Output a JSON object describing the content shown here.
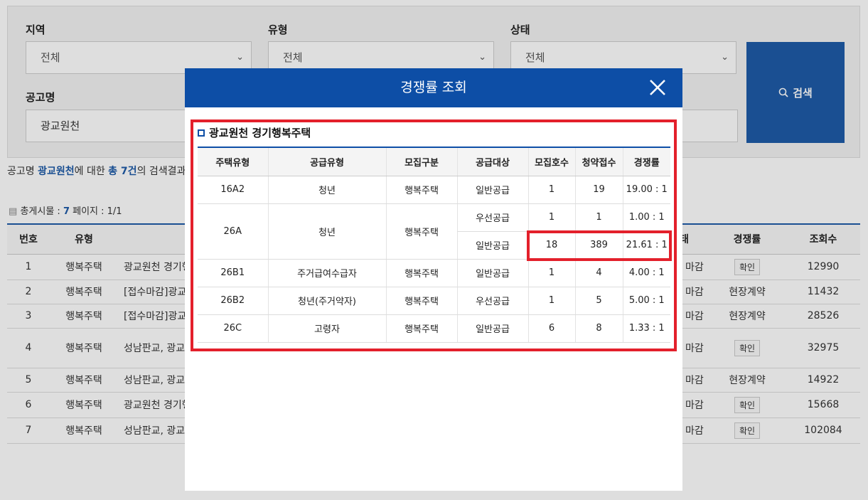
{
  "search": {
    "region_label": "지역",
    "region_value": "전체",
    "type_label": "유형",
    "type_value": "전체",
    "status_label": "상태",
    "status_value": "전체",
    "notice_label": "공고명",
    "notice_value": "광교원천",
    "search_button": "검색"
  },
  "summary": {
    "prefix": "공고명 ",
    "keyword": "광교원천",
    "middle": "에 대한 ",
    "count": "총 7건",
    "suffix": "의 검색결과"
  },
  "list_meta": {
    "total_label": "총게시물 : ",
    "total_value": "7",
    "page_label": " 페이지 : ",
    "page_value": "1/1"
  },
  "list_table": {
    "headers": [
      "번호",
      "유형",
      "",
      "",
      "경쟁률",
      "조회수"
    ],
    "status_header_tail": "태",
    "rows": [
      {
        "no": "1",
        "type": "행복주택",
        "title": "광교원천 경기행",
        "status": "마감",
        "rate": "확인",
        "rate_is_button": true,
        "views": "12990"
      },
      {
        "no": "2",
        "type": "행복주택",
        "title": "[접수마감]광교",
        "status": "마감",
        "rate": "현장계약",
        "rate_is_button": false,
        "views": "11432"
      },
      {
        "no": "3",
        "type": "행복주택",
        "title": "[접수마감]광교",
        "status": "마감",
        "rate": "현장계약",
        "rate_is_button": false,
        "views": "28526"
      },
      {
        "no": "4",
        "type": "행복주택",
        "title": "성남판교, 광교",
        "status": "마감",
        "rate": "확인",
        "rate_is_button": true,
        "views": "32975"
      },
      {
        "no": "5",
        "type": "행복주택",
        "title": "성남판교, 광교",
        "status": "마감",
        "rate": "현장계약",
        "rate_is_button": false,
        "views": "14922"
      },
      {
        "no": "6",
        "type": "행복주택",
        "title": "광교원천 경기행",
        "status": "마감",
        "rate": "확인",
        "rate_is_button": true,
        "views": "15668"
      },
      {
        "no": "7",
        "type": "행복주택",
        "title": "성남판교, 광교",
        "status": "마감",
        "rate": "확인",
        "rate_is_button": true,
        "views": "102084"
      }
    ]
  },
  "modal": {
    "title": "경쟁률 조회",
    "subtitle": "광교원천 경기행복주택",
    "columns": [
      "주택유형",
      "공급유형",
      "모집구분",
      "공급대상",
      "모집호수",
      "청약접수",
      "경쟁률"
    ],
    "rows": [
      {
        "house_type": "16A2",
        "supply_type": "청년",
        "category": "행복주택",
        "target": "일반공급",
        "units": "1",
        "applications": "19",
        "rate": "19.00 : 1"
      },
      {
        "house_type": "26A",
        "supply_type": "청년",
        "category": "행복주택",
        "target": "우선공급",
        "units": "1",
        "applications": "1",
        "rate": "1.00 : 1"
      },
      {
        "target": "일반공급",
        "units": "18",
        "applications": "389",
        "rate": "21.61 : 1"
      },
      {
        "house_type": "26B1",
        "supply_type": "주거급여수급자",
        "category": "행복주택",
        "target": "일반공급",
        "units": "1",
        "applications": "4",
        "rate": "4.00 : 1"
      },
      {
        "house_type": "26B2",
        "supply_type": "청년(주거약자)",
        "category": "행복주택",
        "target": "우선공급",
        "units": "1",
        "applications": "5",
        "rate": "5.00 : 1"
      },
      {
        "house_type": "26C",
        "supply_type": "고령자",
        "category": "행복주택",
        "target": "일반공급",
        "units": "6",
        "applications": "8",
        "rate": "1.33 : 1"
      }
    ]
  },
  "colors": {
    "brand_blue": "#0d4ea6",
    "highlight_red": "#e3202b"
  }
}
